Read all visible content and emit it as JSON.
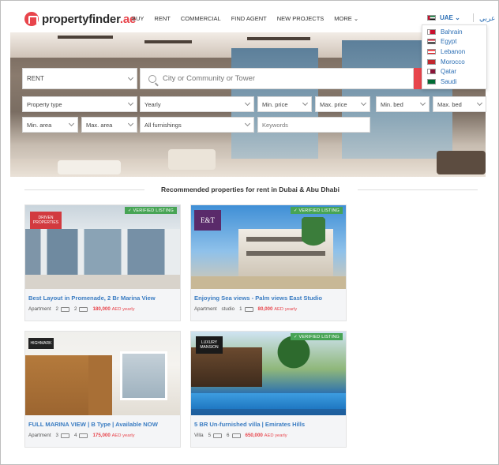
{
  "header": {
    "logo_name": "propertyfinder",
    "logo_tld": ".ae",
    "nav": [
      "BUY",
      "RENT",
      "COMMERCIAL",
      "FIND AGENT",
      "NEW PROJECTS",
      "MORE ⌄"
    ],
    "country_selected": "UAE ⌄",
    "arabic_label": "عربي",
    "countries": [
      {
        "name": "Bahrain",
        "flag_color": "#c8102e"
      },
      {
        "name": "Egypt",
        "flag_color": "#222222"
      },
      {
        "name": "Lebanon",
        "flag_color": "#c8102e"
      },
      {
        "name": "Morocco",
        "flag_color": "#c1272d"
      },
      {
        "name": "Qatar",
        "flag_color": "#8a1538"
      },
      {
        "name": "Saudi",
        "flag_color": "#006c35"
      }
    ]
  },
  "search": {
    "mode": "RENT",
    "location_placeholder": "City or Community or Tower",
    "property_type": "Property type",
    "period": "Yearly",
    "min_price": "Min. price",
    "max_price": "Max. price",
    "min_bed": "Min. bed",
    "max_bed": "Max. bed",
    "min_area": "Min. area",
    "max_area": "Max. area",
    "furnishing": "All furnishings",
    "keywords_placeholder": "Keywords"
  },
  "section": {
    "title": "Recommended properties for rent in Dubai & Abu Dhabi"
  },
  "listings": [
    {
      "title": "Best Layout in Promenade, 2 Br Marina View",
      "type": "Apartment",
      "beds": "2",
      "baths": "2",
      "price": "180,000",
      "unit": "AED yearly",
      "verified": "✓ VERIFIED LISTING",
      "brand": "DRIVEN PROPERTIES"
    },
    {
      "title": "Enjoying Sea views - Palm views East Studio",
      "type": "Apartment",
      "beds": "studio",
      "baths": "1",
      "price": "80,000",
      "unit": "AED yearly",
      "verified": "✓ VERIFIED LISTING",
      "brand": "E&T"
    },
    {
      "title": "FULL MARINA VIEW | B Type | Available NOW",
      "type": "Apartment",
      "beds": "3",
      "baths": "4",
      "price": "175,000",
      "unit": "AED yearly",
      "verified": "",
      "brand": "HIGHMARK"
    },
    {
      "title": "5 BR Un-furnished villa | Emirates Hills",
      "type": "Villa",
      "beds": "5",
      "baths": "6",
      "price": "650,000",
      "unit": "AED yearly",
      "verified": "✓ VERIFIED LISTING",
      "brand": "LUXURY MANSION"
    }
  ],
  "colors": {
    "brand_red": "#e8454c",
    "link_blue": "#3a7cc2",
    "verified_green": "#47a455"
  }
}
